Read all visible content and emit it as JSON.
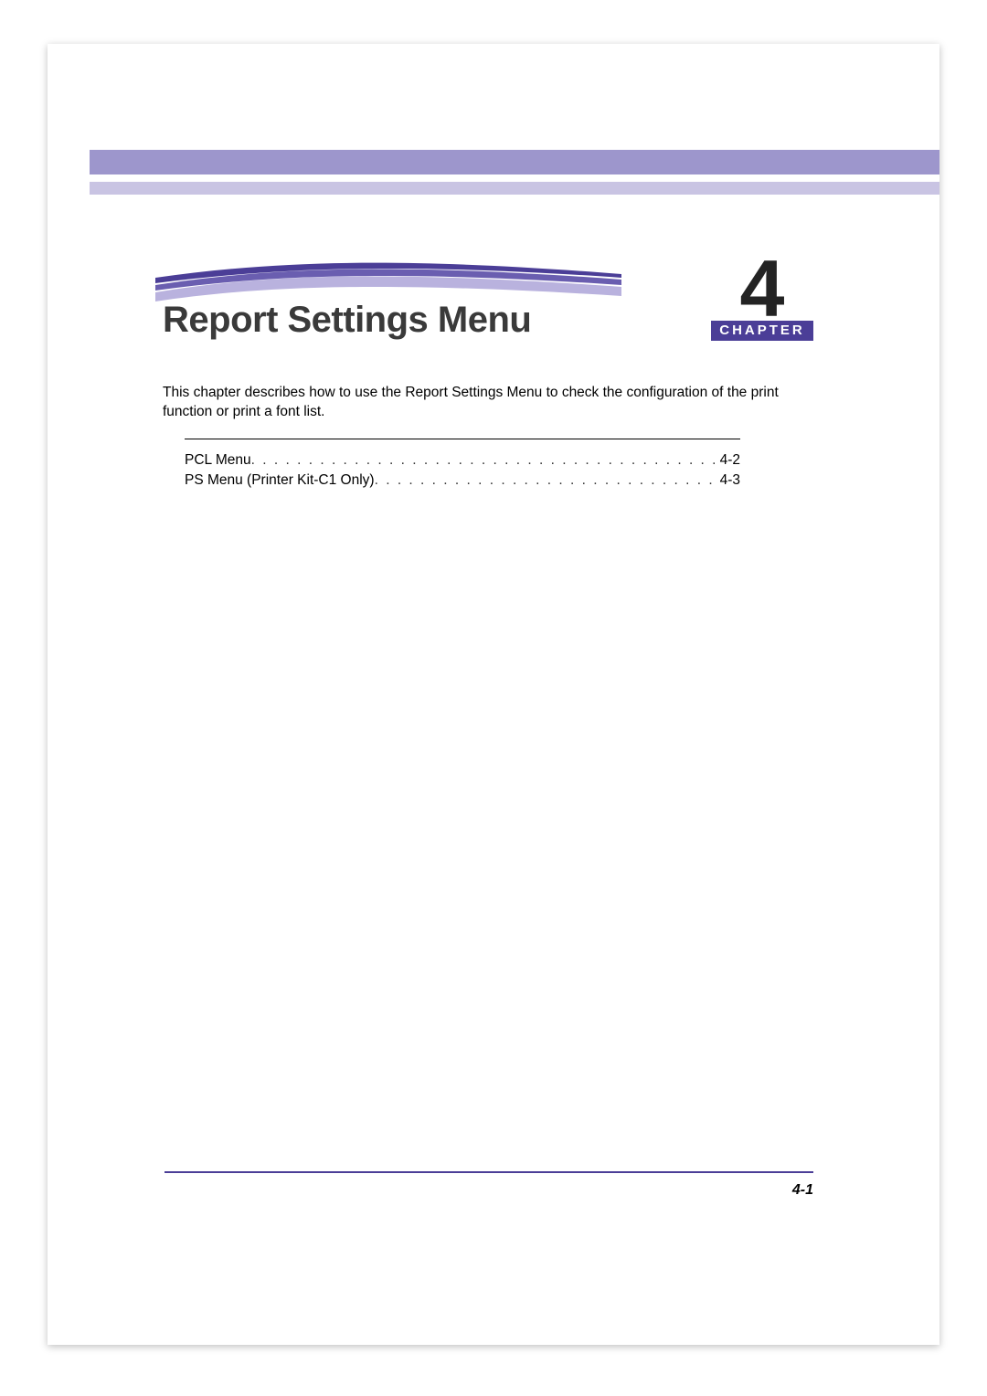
{
  "chapter": {
    "title": "Report Settings Menu",
    "number": "4",
    "label": "CHAPTER"
  },
  "intro": "This chapter describes how to use the Report Settings Menu to check the configuration of the print function or print a font list.",
  "toc": [
    {
      "label": "PCL Menu",
      "page": "4-2"
    },
    {
      "label": "PS Menu (Printer Kit-C1 Only)",
      "page": "4-3"
    }
  ],
  "footer": {
    "page_number": "4-1"
  },
  "colors": {
    "band_top": "#9d96cc",
    "band_bottom": "#c9c4e3",
    "accent": "#4b3e97"
  }
}
